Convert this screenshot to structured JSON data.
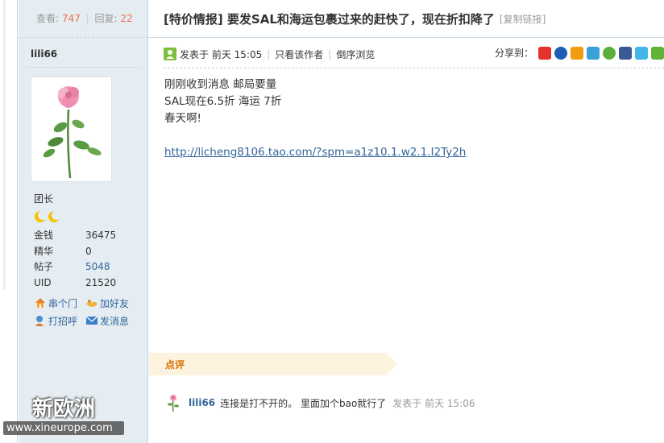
{
  "stats": {
    "views_label": "查看:",
    "views": "747",
    "replies_label": "回复:",
    "replies": "22"
  },
  "author": {
    "name": "lili66",
    "rank": "团长",
    "info": [
      {
        "k": "金钱",
        "v": "36475"
      },
      {
        "k": "精华",
        "v": "0"
      },
      {
        "k": "帖子",
        "v": "5048"
      },
      {
        "k": "UID",
        "v": "21520"
      }
    ],
    "actions": {
      "visit": "串个门",
      "add_friend": "加好友",
      "poke": "打招呼",
      "message": "发消息"
    }
  },
  "thread": {
    "title": "[特价情报] 要发SAL和海运包裹过来的赶快了，现在折扣降了",
    "copy_link": "[复制链接]"
  },
  "meta": {
    "posted": "发表于 前天 15:05",
    "author_only": "只看该作者",
    "reverse": "倒序浏览",
    "share_label": "分享到："
  },
  "content": {
    "line1": "刚刚收到消息   邮局要量",
    "line2": "SAL现在6.5折     海运  7折",
    "line3": "春天啊!",
    "link": "http://licheng8106.tao.com/?spm=a1z10.1.w2.1.I2Ty2h"
  },
  "review": {
    "label": "点评"
  },
  "comment": {
    "user": "lili66",
    "text": "连接是打不开的。 里面加个bao就行了",
    "time": "发表于 前天 15:06"
  },
  "watermark": {
    "big": "新欧洲",
    "url": "www.xineurope.com"
  },
  "colors": {
    "sidebar_bg": "#e5edf2",
    "link": "#336699",
    "accent": "#f26c4f",
    "review_bg": "#fdf2de"
  }
}
